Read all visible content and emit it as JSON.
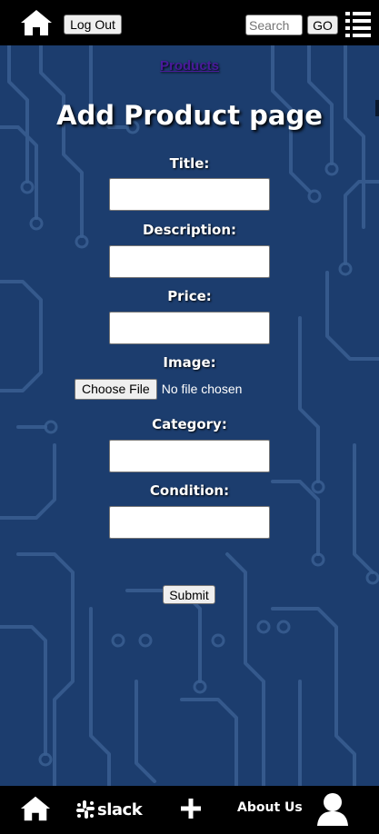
{
  "header": {
    "logout_label": "Log Out",
    "search_placeholder": "Search",
    "go_label": "GO",
    "icons": [
      "home-icon",
      "menu-icon"
    ]
  },
  "main": {
    "products_link": "Products",
    "title": "Add Product page",
    "fields": {
      "title_label": "Title:",
      "title_value": "",
      "description_label": "Description:",
      "description_value": "",
      "price_label": "Price:",
      "price_value": "",
      "image_label": "Image:",
      "choose_file_label": "Choose File",
      "file_status": "No file chosen",
      "category_label": "Category:",
      "category_value": "",
      "condition_label": "Condition:",
      "condition_value": ""
    },
    "submit_label": "Submit"
  },
  "footer": {
    "slack_label": "slack",
    "about_label": "About Us",
    "icons": [
      "home-icon",
      "slack-icon",
      "plus-icon",
      "user-icon"
    ]
  },
  "colors": {
    "bar": "#000000",
    "background": "#1c3d6e",
    "circuit": "#3a5f92",
    "link": "#4a1a9c"
  }
}
